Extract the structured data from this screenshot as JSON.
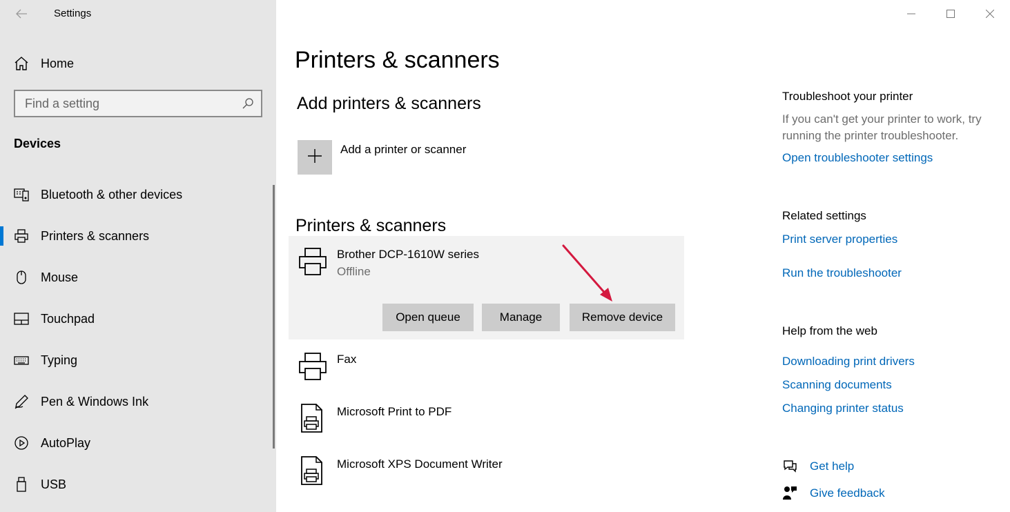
{
  "window": {
    "app_title": "Settings",
    "back_icon": "back-arrow-icon",
    "controls": [
      "minimize-icon",
      "maximize-icon",
      "close-icon"
    ]
  },
  "sidebar": {
    "home_label": "Home",
    "search_placeholder": "Find a setting",
    "section_header": "Devices",
    "items": [
      {
        "label": "Bluetooth & other devices",
        "icon": "bluetooth-devices-icon"
      },
      {
        "label": "Printers & scanners",
        "icon": "printer-icon",
        "active": true
      },
      {
        "label": "Mouse",
        "icon": "mouse-icon"
      },
      {
        "label": "Touchpad",
        "icon": "touchpad-icon"
      },
      {
        "label": "Typing",
        "icon": "keyboard-icon"
      },
      {
        "label": "Pen & Windows Ink",
        "icon": "pen-icon"
      },
      {
        "label": "AutoPlay",
        "icon": "autoplay-icon"
      },
      {
        "label": "USB",
        "icon": "usb-icon"
      }
    ]
  },
  "main": {
    "page_title": "Printers & scanners",
    "add_section_title": "Add printers & scanners",
    "add_label": "Add a printer or scanner",
    "list_section_title": "Printers & scanners",
    "printers": [
      {
        "name": "Brother DCP-1610W series",
        "status": "Offline",
        "expanded": true
      },
      {
        "name": "Fax",
        "status": ""
      },
      {
        "name": "Microsoft Print to PDF",
        "status": ""
      },
      {
        "name": "Microsoft XPS Document Writer",
        "status": ""
      }
    ],
    "buttons": {
      "open_queue": "Open queue",
      "manage": "Manage",
      "remove_device": "Remove device"
    },
    "annotation_color": "#d4193f"
  },
  "right_column": {
    "troubleshoot_title": "Troubleshoot your printer",
    "troubleshoot_text": "If you can't get your printer to work, try running the printer troubleshooter.",
    "troubleshoot_link": "Open troubleshooter settings",
    "related_title": "Related settings",
    "related_links": [
      "Print server properties",
      "Run the troubleshooter"
    ],
    "help_title": "Help from the web",
    "help_links": [
      "Downloading print drivers",
      "Scanning documents",
      "Changing printer status"
    ],
    "get_help": "Get help",
    "give_feedback": "Give feedback"
  },
  "colors": {
    "accent": "#0078d4",
    "link": "#0067b8",
    "sidebar_bg": "#e6e6e6"
  }
}
